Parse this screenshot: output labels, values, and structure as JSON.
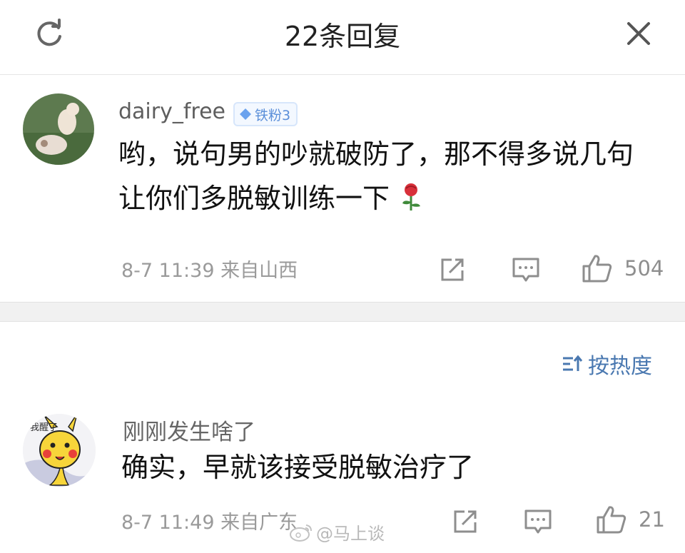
{
  "header": {
    "title": "22条回复"
  },
  "main_comment": {
    "username": "dairy_free",
    "badge": "铁粉3",
    "text_line1": "哟，说句男的吵就破防了，那不得多说几句",
    "text_line2": "让你们多脱敏训练一下",
    "time": "8-7 11:39",
    "location": "来自山西",
    "likes": "504",
    "emoji": "rose"
  },
  "sort": {
    "label": "按热度"
  },
  "reply": {
    "username": "刚刚发生啥了",
    "avatar_text": "我醒了",
    "text": "确实，早就该接受脱敏治疗了",
    "time": "8-7 11:49",
    "location": "来自广东",
    "likes": "21"
  },
  "watermark": {
    "text": "@马上谈"
  },
  "colors": {
    "link_blue": "#4a78b0",
    "badge_blue": "#5b8fd9",
    "meta_gray": "#9a9a9a"
  },
  "icons": [
    "refresh-icon",
    "close-icon",
    "share-icon",
    "comment-icon",
    "like-icon",
    "sort-icon",
    "rose-icon",
    "weibo-logo-icon"
  ]
}
